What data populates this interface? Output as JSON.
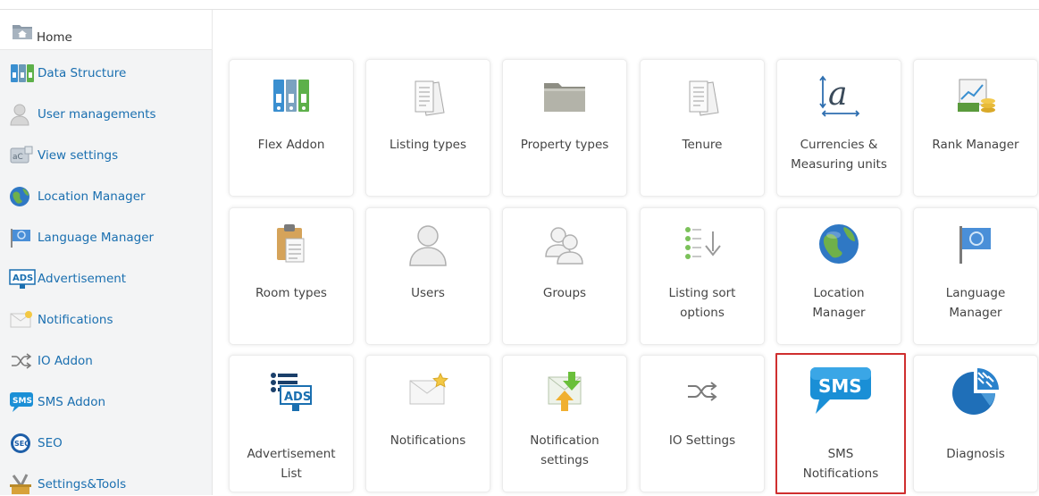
{
  "home": {
    "label": "Home"
  },
  "sidebar": {
    "items": [
      {
        "label": "Data Structure",
        "icon": "binders-icon"
      },
      {
        "label": "User managements",
        "icon": "user-icon"
      },
      {
        "label": "View settings",
        "icon": "view-settings-icon"
      },
      {
        "label": "Location Manager",
        "icon": "globe-icon"
      },
      {
        "label": "Language Manager",
        "icon": "flag-icon"
      },
      {
        "label": "Advertisement",
        "icon": "ads-icon"
      },
      {
        "label": "Notifications",
        "icon": "envelope-icon"
      },
      {
        "label": "IO Addon",
        "icon": "shuffle-icon"
      },
      {
        "label": "SMS Addon",
        "icon": "sms-icon"
      },
      {
        "label": "SEO",
        "icon": "seo-icon"
      },
      {
        "label": "Settings&Tools",
        "icon": "tools-icon"
      }
    ]
  },
  "tiles": [
    {
      "label": "Flex Addon",
      "icon": "binders-icon"
    },
    {
      "label": "Listing types",
      "icon": "documents-icon"
    },
    {
      "label": "Property types",
      "icon": "folder-icon"
    },
    {
      "label": "Tenure",
      "icon": "documents-icon"
    },
    {
      "label": "Currencies & Measuring units",
      "label_lines": [
        "Currencies &",
        "Measuring units"
      ],
      "icon": "measure-a-icon"
    },
    {
      "label": "Rank Manager",
      "icon": "chart-coins-icon"
    },
    {
      "label": "Room types",
      "icon": "clipboard-icon"
    },
    {
      "label": "Users",
      "icon": "user-icon"
    },
    {
      "label": "Groups",
      "icon": "group-icon"
    },
    {
      "label": "Listing sort options",
      "label_lines": [
        "Listing sort",
        "options"
      ],
      "icon": "sort-list-icon"
    },
    {
      "label": "Location Manager",
      "label_lines": [
        "Location",
        "Manager"
      ],
      "icon": "globe-icon"
    },
    {
      "label": "Language Manager",
      "label_lines": [
        "Language",
        "Manager"
      ],
      "icon": "flag-icon"
    },
    {
      "label": "Advertisement List",
      "label_lines": [
        "Advertisement",
        "List"
      ],
      "icon": "ads-list-icon"
    },
    {
      "label": "Notifications",
      "icon": "envelope-star-icon"
    },
    {
      "label": "Notification settings",
      "label_lines": [
        "Notification",
        "settings"
      ],
      "icon": "notification-settings-icon"
    },
    {
      "label": "IO Settings",
      "icon": "shuffle-icon"
    },
    {
      "label": "SMS Notifications",
      "label_lines": [
        "SMS",
        "Notifications"
      ],
      "icon": "sms-icon",
      "selected": true
    },
    {
      "label": "Diagnosis",
      "icon": "pie-chart-icon"
    }
  ],
  "colors": {
    "link": "#1a6fb0",
    "selected_border": "#cf2f2f",
    "sidebar_bg": "#f3f4f5",
    "sms_blue": "#1a8fd6"
  }
}
